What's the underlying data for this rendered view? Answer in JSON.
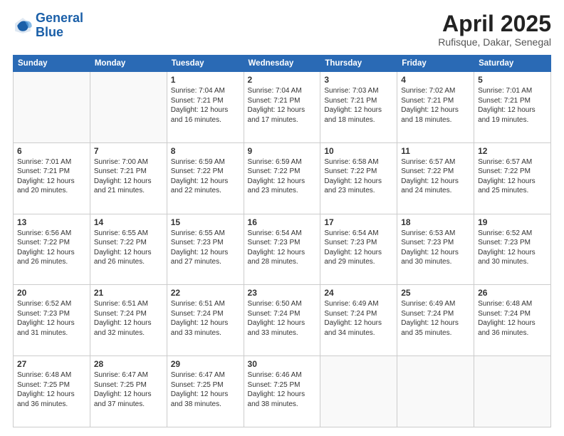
{
  "header": {
    "logo_line1": "General",
    "logo_line2": "Blue",
    "month": "April 2025",
    "location": "Rufisque, Dakar, Senegal"
  },
  "weekdays": [
    "Sunday",
    "Monday",
    "Tuesday",
    "Wednesday",
    "Thursday",
    "Friday",
    "Saturday"
  ],
  "weeks": [
    [
      {
        "day": "",
        "info": ""
      },
      {
        "day": "",
        "info": ""
      },
      {
        "day": "1",
        "info": "Sunrise: 7:04 AM\nSunset: 7:21 PM\nDaylight: 12 hours and 16 minutes."
      },
      {
        "day": "2",
        "info": "Sunrise: 7:04 AM\nSunset: 7:21 PM\nDaylight: 12 hours and 17 minutes."
      },
      {
        "day": "3",
        "info": "Sunrise: 7:03 AM\nSunset: 7:21 PM\nDaylight: 12 hours and 18 minutes."
      },
      {
        "day": "4",
        "info": "Sunrise: 7:02 AM\nSunset: 7:21 PM\nDaylight: 12 hours and 18 minutes."
      },
      {
        "day": "5",
        "info": "Sunrise: 7:01 AM\nSunset: 7:21 PM\nDaylight: 12 hours and 19 minutes."
      }
    ],
    [
      {
        "day": "6",
        "info": "Sunrise: 7:01 AM\nSunset: 7:21 PM\nDaylight: 12 hours and 20 minutes."
      },
      {
        "day": "7",
        "info": "Sunrise: 7:00 AM\nSunset: 7:21 PM\nDaylight: 12 hours and 21 minutes."
      },
      {
        "day": "8",
        "info": "Sunrise: 6:59 AM\nSunset: 7:22 PM\nDaylight: 12 hours and 22 minutes."
      },
      {
        "day": "9",
        "info": "Sunrise: 6:59 AM\nSunset: 7:22 PM\nDaylight: 12 hours and 23 minutes."
      },
      {
        "day": "10",
        "info": "Sunrise: 6:58 AM\nSunset: 7:22 PM\nDaylight: 12 hours and 23 minutes."
      },
      {
        "day": "11",
        "info": "Sunrise: 6:57 AM\nSunset: 7:22 PM\nDaylight: 12 hours and 24 minutes."
      },
      {
        "day": "12",
        "info": "Sunrise: 6:57 AM\nSunset: 7:22 PM\nDaylight: 12 hours and 25 minutes."
      }
    ],
    [
      {
        "day": "13",
        "info": "Sunrise: 6:56 AM\nSunset: 7:22 PM\nDaylight: 12 hours and 26 minutes."
      },
      {
        "day": "14",
        "info": "Sunrise: 6:55 AM\nSunset: 7:22 PM\nDaylight: 12 hours and 26 minutes."
      },
      {
        "day": "15",
        "info": "Sunrise: 6:55 AM\nSunset: 7:23 PM\nDaylight: 12 hours and 27 minutes."
      },
      {
        "day": "16",
        "info": "Sunrise: 6:54 AM\nSunset: 7:23 PM\nDaylight: 12 hours and 28 minutes."
      },
      {
        "day": "17",
        "info": "Sunrise: 6:54 AM\nSunset: 7:23 PM\nDaylight: 12 hours and 29 minutes."
      },
      {
        "day": "18",
        "info": "Sunrise: 6:53 AM\nSunset: 7:23 PM\nDaylight: 12 hours and 30 minutes."
      },
      {
        "day": "19",
        "info": "Sunrise: 6:52 AM\nSunset: 7:23 PM\nDaylight: 12 hours and 30 minutes."
      }
    ],
    [
      {
        "day": "20",
        "info": "Sunrise: 6:52 AM\nSunset: 7:23 PM\nDaylight: 12 hours and 31 minutes."
      },
      {
        "day": "21",
        "info": "Sunrise: 6:51 AM\nSunset: 7:24 PM\nDaylight: 12 hours and 32 minutes."
      },
      {
        "day": "22",
        "info": "Sunrise: 6:51 AM\nSunset: 7:24 PM\nDaylight: 12 hours and 33 minutes."
      },
      {
        "day": "23",
        "info": "Sunrise: 6:50 AM\nSunset: 7:24 PM\nDaylight: 12 hours and 33 minutes."
      },
      {
        "day": "24",
        "info": "Sunrise: 6:49 AM\nSunset: 7:24 PM\nDaylight: 12 hours and 34 minutes."
      },
      {
        "day": "25",
        "info": "Sunrise: 6:49 AM\nSunset: 7:24 PM\nDaylight: 12 hours and 35 minutes."
      },
      {
        "day": "26",
        "info": "Sunrise: 6:48 AM\nSunset: 7:24 PM\nDaylight: 12 hours and 36 minutes."
      }
    ],
    [
      {
        "day": "27",
        "info": "Sunrise: 6:48 AM\nSunset: 7:25 PM\nDaylight: 12 hours and 36 minutes."
      },
      {
        "day": "28",
        "info": "Sunrise: 6:47 AM\nSunset: 7:25 PM\nDaylight: 12 hours and 37 minutes."
      },
      {
        "day": "29",
        "info": "Sunrise: 6:47 AM\nSunset: 7:25 PM\nDaylight: 12 hours and 38 minutes."
      },
      {
        "day": "30",
        "info": "Sunrise: 6:46 AM\nSunset: 7:25 PM\nDaylight: 12 hours and 38 minutes."
      },
      {
        "day": "",
        "info": ""
      },
      {
        "day": "",
        "info": ""
      },
      {
        "day": "",
        "info": ""
      }
    ]
  ]
}
